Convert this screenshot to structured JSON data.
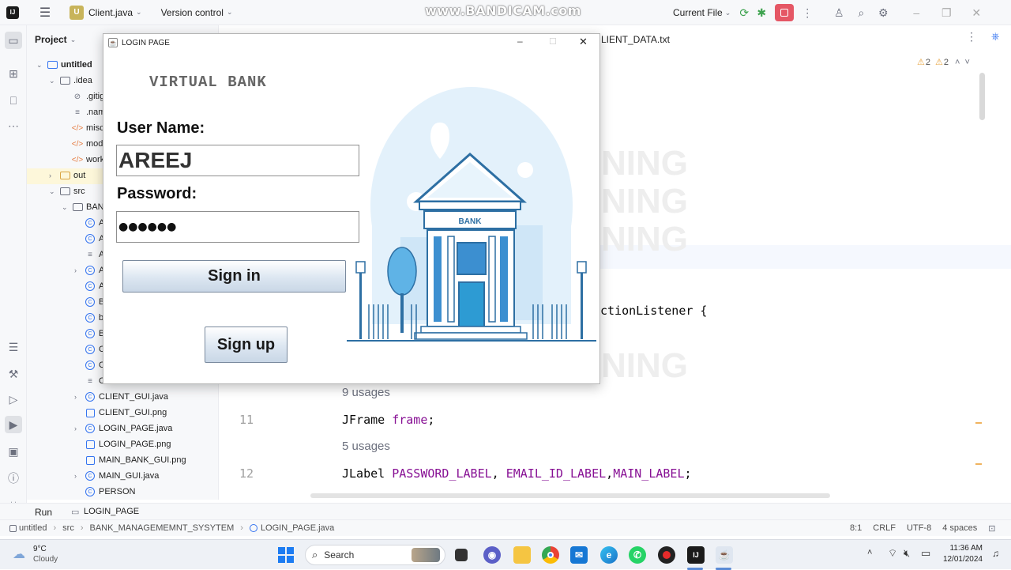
{
  "ide": {
    "tab_file": "Client.java",
    "vcs": "Version control",
    "run_config": "Current File",
    "watermark": "www.BANDICAM.com",
    "project_label": "Project",
    "hidden_tab": "LIENT_DATA.txt",
    "warnings": "2",
    "weak_warnings": "2"
  },
  "tree": [
    {
      "label": "untitled",
      "indent": 0,
      "arrow": "⌄",
      "kind": "module"
    },
    {
      "label": ".idea",
      "indent": 1,
      "arrow": "⌄",
      "kind": "folder"
    },
    {
      "label": ".gitig",
      "indent": 2,
      "arrow": "",
      "kind": "ignore"
    },
    {
      "label": ".nam",
      "indent": 2,
      "arrow": "",
      "kind": "text"
    },
    {
      "label": "misc",
      "indent": 2,
      "arrow": "",
      "kind": "xml"
    },
    {
      "label": "mod",
      "indent": 2,
      "arrow": "",
      "kind": "xml"
    },
    {
      "label": "work",
      "indent": 2,
      "arrow": "",
      "kind": "xml"
    },
    {
      "label": "out",
      "indent": 1,
      "arrow": "›",
      "kind": "folder-out"
    },
    {
      "label": "src",
      "indent": 1,
      "arrow": "⌄",
      "kind": "folder"
    },
    {
      "label": "BAN",
      "indent": 2,
      "arrow": "⌄",
      "kind": "folder"
    },
    {
      "label": "A",
      "indent": 3,
      "arrow": "",
      "kind": "class"
    },
    {
      "label": "A",
      "indent": 3,
      "arrow": "",
      "kind": "class"
    },
    {
      "label": "A",
      "indent": 3,
      "arrow": "",
      "kind": "text"
    },
    {
      "label": "A",
      "indent": 3,
      "arrow": "›",
      "kind": "class"
    },
    {
      "label": "A",
      "indent": 3,
      "arrow": "",
      "kind": "class"
    },
    {
      "label": "B",
      "indent": 3,
      "arrow": "",
      "kind": "class"
    },
    {
      "label": "b",
      "indent": 3,
      "arrow": "",
      "kind": "class"
    },
    {
      "label": "B",
      "indent": 3,
      "arrow": "",
      "kind": "class"
    },
    {
      "label": "C",
      "indent": 3,
      "arrow": "",
      "kind": "class"
    },
    {
      "label": "C",
      "indent": 3,
      "arrow": "",
      "kind": "class"
    },
    {
      "label": "C",
      "indent": 3,
      "arrow": "",
      "kind": "text"
    },
    {
      "label": "CLIENT_GUI.java",
      "indent": 3,
      "arrow": "›",
      "kind": "class"
    },
    {
      "label": "CLIENT_GUI.png",
      "indent": 3,
      "arrow": "",
      "kind": "image"
    },
    {
      "label": "LOGIN_PAGE.java",
      "indent": 3,
      "arrow": "›",
      "kind": "class"
    },
    {
      "label": "LOGIN_PAGE.png",
      "indent": 3,
      "arrow": "",
      "kind": "image"
    },
    {
      "label": "MAIN_BANK_GUI.png",
      "indent": 3,
      "arrow": "",
      "kind": "image"
    },
    {
      "label": "MAIN_GUI.java",
      "indent": 3,
      "arrow": "›",
      "kind": "class"
    },
    {
      "label": "PERSON",
      "indent": 3,
      "arrow": "",
      "kind": "class"
    }
  ],
  "editor": {
    "code_fragment": "ctionListener {",
    "usage1": "9 usages",
    "line11_no": "11",
    "line11_type": "JFrame",
    "line11_field": "frame",
    "line11_end": ";",
    "usage2": "5 usages",
    "line12_no": "12",
    "line12_type": "JLabel",
    "line12_f1": "PASSWORD_LABEL",
    "line12_sep1": ", ",
    "line12_f2": "EMAIL_ID_LABEL",
    "line12_sep2": ",",
    "line12_f3": "MAIN_LABEL",
    "line12_end": ";",
    "faded1": "NING",
    "faded2": "NING",
    "faded3": "NING",
    "faded4": "NING"
  },
  "run_bar": {
    "run": "Run",
    "tab": "LOGIN_PAGE"
  },
  "status": {
    "crumb1": "untitled",
    "crumb2": "src",
    "crumb3": "BANK_MANAGEMEMNT_SYSYTEM",
    "crumb4": "LOGIN_PAGE.java",
    "position": "8:1",
    "line_sep": "CRLF",
    "encoding": "UTF-8",
    "indent": "4 spaces"
  },
  "login": {
    "window_title": "LOGIN PAGE",
    "heading": "VIRTUAL BANK",
    "username_label": "User Name:",
    "username_value": "AREEJ",
    "password_label": "Password:",
    "password_value": "●●●●●●",
    "sign_in": "Sign in",
    "sign_up": "Sign up",
    "bank_sign": "BANK"
  },
  "taskbar": {
    "temp": "9°C",
    "weather": "Cloudy",
    "search": "Search",
    "time": "11:36 AM",
    "date": "12/01/2024"
  }
}
